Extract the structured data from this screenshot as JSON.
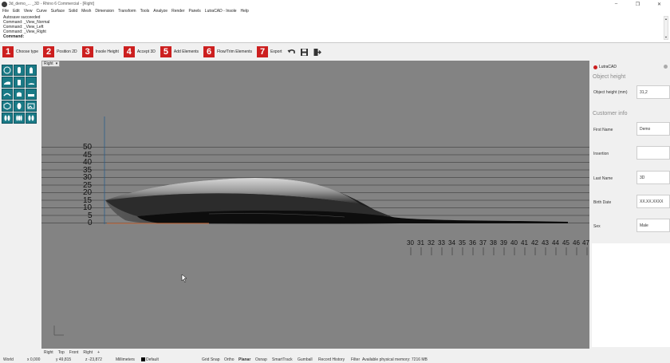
{
  "window": {
    "title": "3d_demo_... _3D - Rhino 6 Commercial - [Right]"
  },
  "menu": [
    "File",
    "Edit",
    "View",
    "Curve",
    "Surface",
    "Solid",
    "Mesh",
    "Dimension",
    "Transform",
    "Tools",
    "Analyze",
    "Render",
    "Panels",
    "LutraCAD - Insole",
    "Help"
  ],
  "command_history": [
    "Autosave succeeded",
    "Command: _View_Normal",
    "Command: _View_Left",
    "Command: _View_Right"
  ],
  "command_prompt": "Command:",
  "toolbar": {
    "steps": [
      {
        "num": "1",
        "label": "Choose type"
      },
      {
        "num": "2",
        "label": "Position 2D"
      },
      {
        "num": "3",
        "label": "Insole Height"
      },
      {
        "num": "4",
        "label": "Accept 3D"
      },
      {
        "num": "5",
        "label": "Add Elements"
      },
      {
        "num": "6",
        "label": "Flow/Trim Elements"
      },
      {
        "num": "7",
        "label": "Export"
      }
    ],
    "icons": [
      "undo-icon",
      "save-icon",
      "exit-icon"
    ]
  },
  "viewport": {
    "name": "Right",
    "scale_left": [
      "50",
      "45",
      "40",
      "35",
      "30",
      "25",
      "20",
      "15",
      "10",
      "5",
      "0"
    ],
    "scale_bottom": [
      "30",
      "31",
      "32",
      "33",
      "34",
      "35",
      "36",
      "37",
      "38",
      "39",
      "40",
      "41",
      "42",
      "43",
      "44",
      "45",
      "46",
      "47"
    ]
  },
  "panel": {
    "header": "LutraCAD",
    "object_section": "Object height",
    "object_height_label": "Object height (mm)",
    "object_height_value": "31,2",
    "customer_section": "Customer info",
    "first_name_label": "First Name",
    "first_name_value": "Demo",
    "insertion_label": "Insertion",
    "insertion_value": "",
    "last_name_label": "Last Name",
    "last_name_value": "3D",
    "birth_date_label": "Birth Date",
    "birth_date_value": "XX.XX.XXXX",
    "sex_label": "Sex",
    "sex_value": "Male"
  },
  "view_tabs": [
    "Right",
    "Top",
    "Front",
    "Right"
  ],
  "status": {
    "cplane": "World",
    "x": "x 0,000",
    "y": "y 49,815",
    "z": "z -23,872",
    "units": "Millimeters",
    "layer": "Default",
    "grid_snap": "Grid Snap",
    "ortho": "Ortho",
    "planar": "Planar",
    "osnap": "Osnap",
    "smarttrack": "SmartTrack",
    "gumball": "Gumball",
    "record_history": "Record History",
    "filter": "Filter",
    "memory": "Available physical memory: 7216 MB"
  },
  "colors": {
    "viewport_bg": "#838383",
    "step_red": "#cc1f1f",
    "icon_teal": "#1a7a86"
  }
}
